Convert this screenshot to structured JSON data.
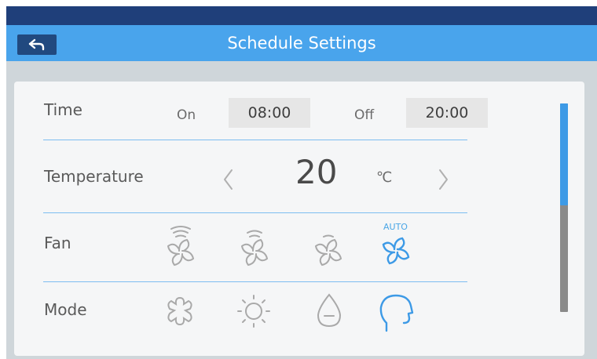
{
  "header": {
    "title": "Schedule Settings"
  },
  "rows": {
    "time": {
      "label": "Time",
      "on_label": "On",
      "on_value": "08:00",
      "off_label": "Off",
      "off_value": "20:00"
    },
    "temperature": {
      "label": "Temperature",
      "value": "20",
      "unit": "℃"
    },
    "fan": {
      "label": "Fan",
      "options": [
        "fan-high-icon",
        "fan-medium-icon",
        "fan-low-icon",
        "fan-auto-icon"
      ],
      "auto_text": "AUTO",
      "selected": "auto"
    },
    "mode": {
      "label": "Mode",
      "options": [
        "cool-icon",
        "heat-icon",
        "dry-icon",
        "auto-mode-icon"
      ],
      "selected": "auto"
    }
  },
  "colors": {
    "header": "#49a4ec",
    "topstrip": "#1f3f7a",
    "back_button": "#21497f",
    "accent": "#3d9ae6",
    "icon_inactive": "#a9a9a9",
    "panel": "#f5f6f7",
    "background": "#cfd6da"
  },
  "scrollbar": {
    "thumb_fraction": 0.49
  }
}
